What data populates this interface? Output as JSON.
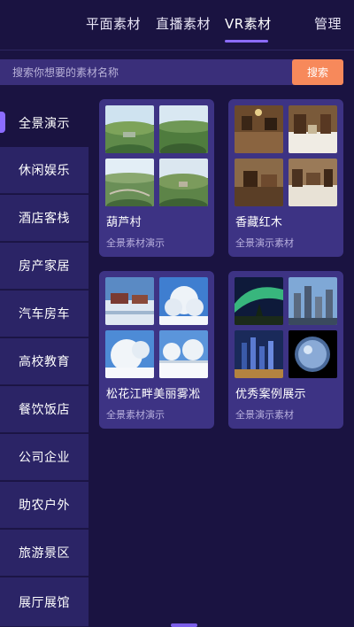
{
  "nav": {
    "tabs": [
      {
        "label": "平面素材"
      },
      {
        "label": "直播素材"
      },
      {
        "label": "VR素材"
      },
      {
        "label": "管理"
      }
    ],
    "active_tab": "VR素材"
  },
  "search": {
    "placeholder": "搜索你想要的素材名称",
    "button_label": "搜索"
  },
  "sidebar": {
    "items": [
      {
        "label": "全景演示"
      },
      {
        "label": "休闲娱乐"
      },
      {
        "label": "酒店客栈"
      },
      {
        "label": "房产家居"
      },
      {
        "label": "汽车房车"
      },
      {
        "label": "高校教育"
      },
      {
        "label": "餐饮饭店"
      },
      {
        "label": "公司企业"
      },
      {
        "label": "助农户外"
      },
      {
        "label": "旅游景区"
      },
      {
        "label": "展厅展馆"
      }
    ],
    "active": "全景演示"
  },
  "cards": [
    {
      "title": "葫芦村",
      "subtitle": "全景素材演示"
    },
    {
      "title": "香藏红木",
      "subtitle": "全景演示素材"
    },
    {
      "title": "松花江畔美丽雾凇",
      "subtitle": "全景素材演示"
    },
    {
      "title": "优秀案例展示",
      "subtitle": "全景演示素材"
    }
  ],
  "colors": {
    "background": "#1a1341",
    "accent": "#8c6cff",
    "search_button": "#f7895b",
    "card": "#3d3384",
    "sidebar_item": "#2b2466"
  }
}
